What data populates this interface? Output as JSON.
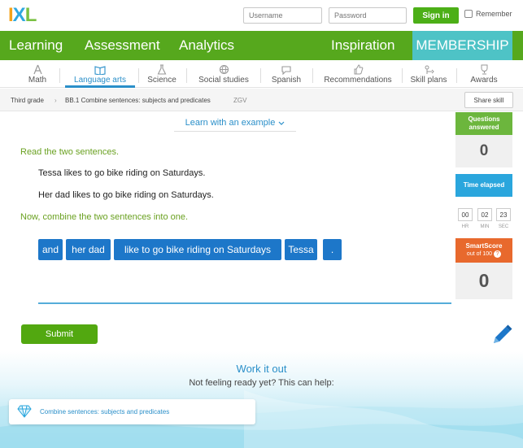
{
  "brand": {
    "logo": "IXL",
    "colors": {
      "green": "#56a81d",
      "teal": "#4ec3c6",
      "blue": "#1d77c9"
    }
  },
  "login": {
    "username_placeholder": "Username",
    "password_placeholder": "Password",
    "signin_label": "Sign in",
    "remember_label": "Remember"
  },
  "mainnav": {
    "items": [
      "Learning",
      "Assessment",
      "Analytics",
      "Inspiration"
    ],
    "membership": "MEMBERSHIP"
  },
  "subjects": {
    "items": [
      {
        "label": "Math",
        "icon": "compass-icon"
      },
      {
        "label": "Language arts",
        "icon": "book-icon"
      },
      {
        "label": "Science",
        "icon": "flask-icon"
      },
      {
        "label": "Social studies",
        "icon": "globe-icon"
      },
      {
        "label": "Spanish",
        "icon": "speech-icon"
      },
      {
        "label": "Recommendations",
        "icon": "thumbs-up-icon"
      },
      {
        "label": "Skill plans",
        "icon": "plan-icon"
      },
      {
        "label": "Awards",
        "icon": "trophy-icon"
      }
    ],
    "active": "Language arts"
  },
  "breadcrumb": {
    "grade": "Third grade",
    "skill": "BB.1 Combine sentences: subjects and predicates",
    "code": "ZGV",
    "share": "Share skill"
  },
  "question": {
    "learn_example": "Learn with an example",
    "prompt1": "Read the two sentences.",
    "sentence1": "Tessa likes to go bike riding on Saturdays.",
    "sentence2": "Her dad likes to go bike riding on Saturdays.",
    "prompt2": "Now, combine the two sentences into one.",
    "tiles": [
      "and",
      "her dad",
      "like to go bike riding on Saturdays",
      "Tessa",
      "."
    ],
    "submit": "Submit"
  },
  "sidebar": {
    "questions_answered_label": "Questions answered",
    "questions_answered_value": "0",
    "time_label": "Time elapsed",
    "time": {
      "hr": "00",
      "min": "02",
      "sec": "23"
    },
    "time_units": {
      "hr": "HR",
      "min": "MIN",
      "sec": "SEC"
    },
    "smartscore_label": "SmartScore",
    "smartscore_sub": "out of 100",
    "smartscore_value": "0"
  },
  "help": {
    "title": "Work it out",
    "subtitle": "Not feeling ready yet? This can help:",
    "lesson": "Combine sentences: subjects and predicates"
  }
}
